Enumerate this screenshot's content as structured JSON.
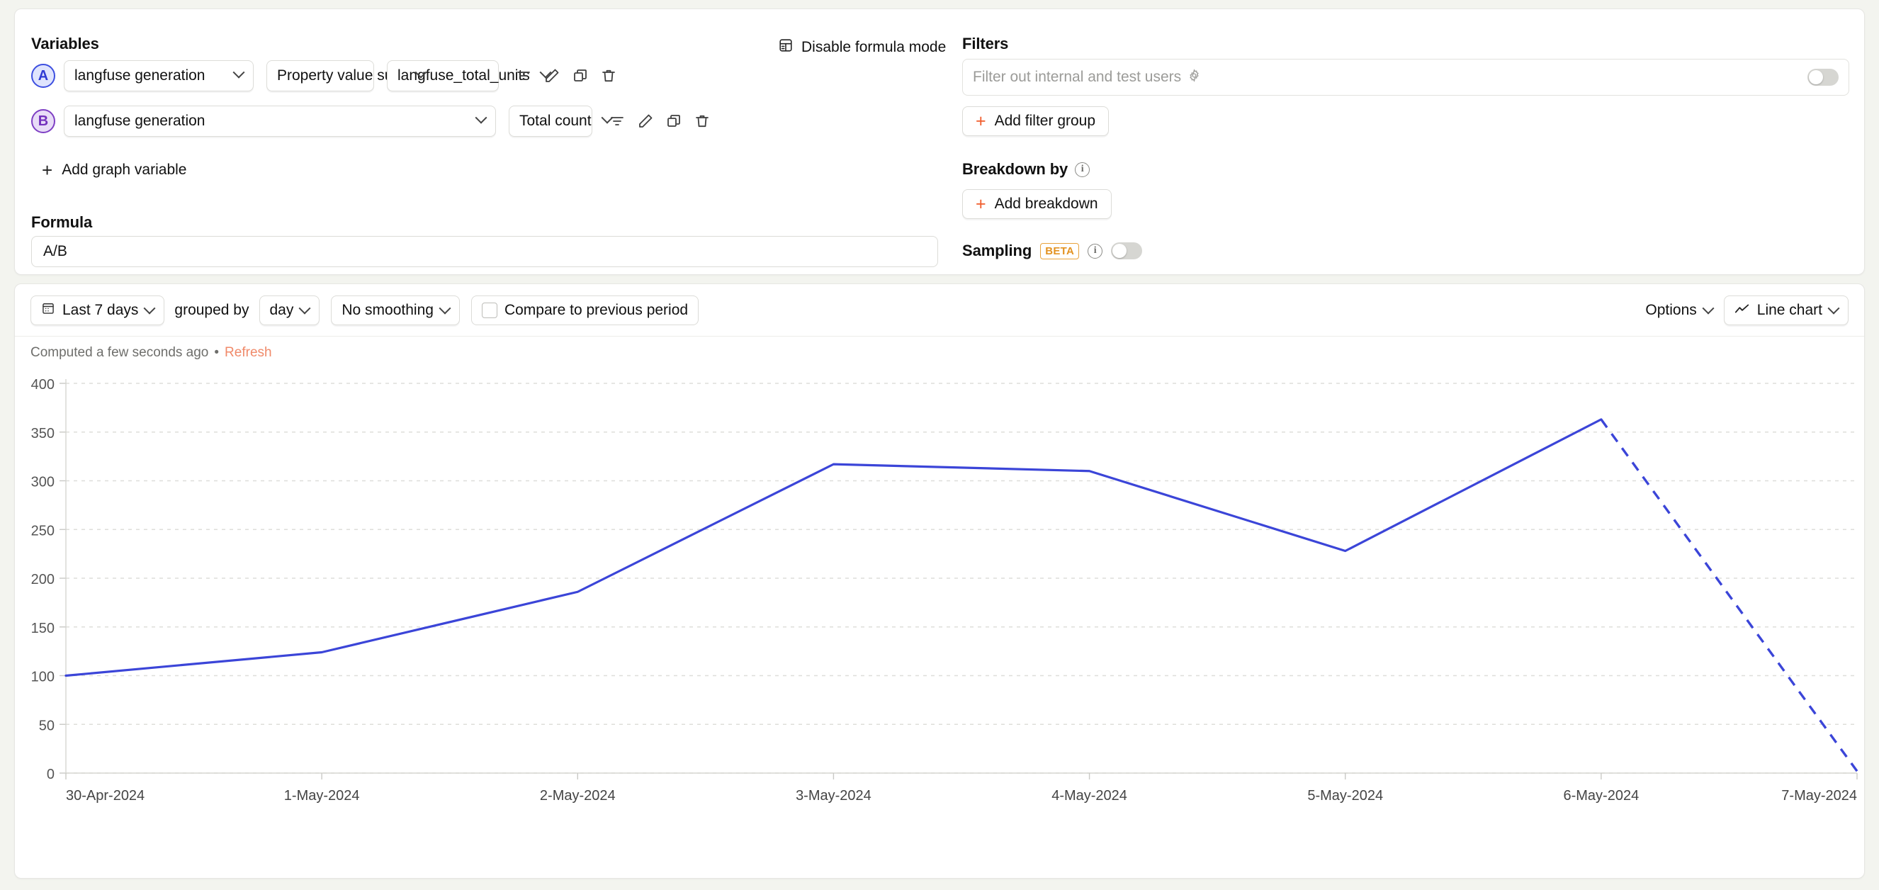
{
  "variables": {
    "section_label": "Variables",
    "add_variable_label": "Add graph variable",
    "rows": [
      {
        "badge": "A",
        "badge_color": "#2f3bd4",
        "event": "langfuse generation",
        "aggregation": "Property value sum",
        "property": "langfuse_total_units"
      },
      {
        "badge": "B",
        "badge_color": "#7330bd",
        "event": "langfuse generation",
        "aggregation": "Total count"
      }
    ],
    "row_actions": [
      "filter-icon",
      "pencil-icon",
      "duplicate-icon",
      "trash-icon"
    ]
  },
  "formula": {
    "label": "Formula",
    "value": "A/B",
    "mode_toggle_label": "Disable formula mode",
    "mode_toggle_icon": "calculator-icon"
  },
  "filters": {
    "section_label": "Filters",
    "internal_filter_placeholder": "Filter out internal and test users",
    "internal_filter_icon": "gear-icon",
    "internal_filter_enabled": false,
    "add_filter_group_label": "Add filter group"
  },
  "breakdown": {
    "label": "Breakdown by",
    "info_icon": "info-icon",
    "add_breakdown_label": "Add breakdown"
  },
  "sampling": {
    "label": "Sampling",
    "badge": "BETA",
    "badge_color": "#e39322",
    "info_icon": "info-icon",
    "enabled": false
  },
  "toolbar": {
    "date_range": "Last 7 days",
    "date_range_icon": "calendar-icon",
    "grouped_by_text": "grouped by",
    "interval": "day",
    "smoothing": "No smoothing",
    "compare_label": "Compare to previous period",
    "compare_checked": false,
    "options_label": "Options",
    "chart_type": "Line chart",
    "chart_type_icon": "line-chart-icon"
  },
  "status": {
    "computed_text": "Computed a few seconds ago",
    "separator": "•",
    "refresh_label": "Refresh",
    "refresh_color": "#f08a6a"
  },
  "chart_data": {
    "type": "line",
    "title": "",
    "xlabel": "",
    "ylabel": "",
    "grid": true,
    "legend": "none",
    "line_color": "#3b45d8",
    "ylim": [
      0,
      400
    ],
    "yticks": [
      0,
      50,
      100,
      150,
      200,
      250,
      300,
      350,
      400
    ],
    "categories": [
      "30-Apr-2024",
      "1-May-2024",
      "2-May-2024",
      "3-May-2024",
      "4-May-2024",
      "5-May-2024",
      "6-May-2024",
      "7-May-2024"
    ],
    "series": [
      {
        "name": "A/B",
        "values": [
          100,
          124,
          186,
          317,
          310,
          228,
          363,
          2
        ],
        "dashed_from_index": 6,
        "note": "final segment drawn dashed (incomplete period)"
      }
    ]
  }
}
